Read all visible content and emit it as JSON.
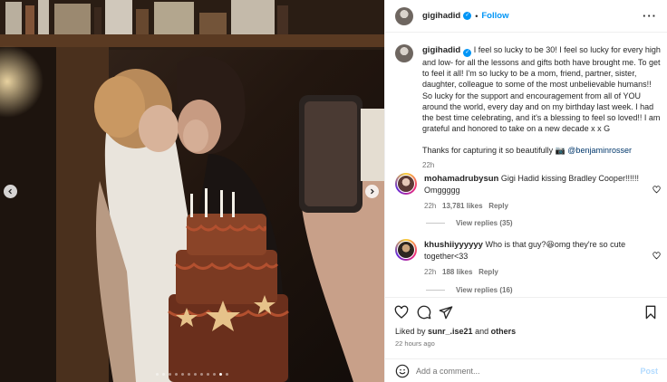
{
  "post": {
    "author": "gigihadid",
    "follow_label": "Follow",
    "more_icon": "more-horizontal-icon",
    "caption": {
      "author": "gigihadid",
      "text": "I feel so lucky to be 30! I feel so lucky for every high and low- for all the lessons and gifts both have brought me. To get to feel it all! I'm so lucky to be a mom, friend, partner, sister, daughter, colleague to some of the most unbelievable humans!! So lucky for the support and encouragement from all of YOU around the world, every day and on my birthday last week. I had the best time celebrating, and it's a blessing to feel so loved!! I am grateful and honored to take on a new decade x x G",
      "thanks": "Thanks for capturing it so beautifully 📷",
      "mention": "@benjaminrosser",
      "time": "22h"
    },
    "comments": [
      {
        "user": "mohamadrubysun",
        "text": "Gigi Hadid kissing Bradley Cooper!!!!!! Omggggg",
        "time": "22h",
        "likes": "13,781 likes",
        "reply_label": "Reply",
        "view_replies": "View replies (35)"
      },
      {
        "user": "khushiiyyyyyy",
        "text": "Who is that guy?😆omg they're so cute together<33",
        "time": "22h",
        "likes": "188 likes",
        "reply_label": "Reply",
        "view_replies": "View replies (16)"
      }
    ],
    "liked_by": {
      "prefix": "Liked by ",
      "user": "sunr_.ise21",
      "mid": " and ",
      "others": "others"
    },
    "posted_ago": "22 hours ago",
    "comment_input_placeholder": "Add a comment...",
    "post_button_label": "Post",
    "carousel": {
      "slides": 12,
      "active_index": 10
    }
  },
  "colors": {
    "accent": "#0095f6",
    "verified": "#0095f6",
    "secondary_text": "#737373",
    "post_disabled": "#b3dbff"
  }
}
